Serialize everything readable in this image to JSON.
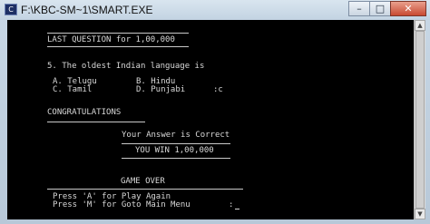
{
  "window": {
    "title": "F:\\KBC-SM~1\\SMART.EXE",
    "icon": "app-icon",
    "controls": {
      "minimize": "–",
      "maximize": "□",
      "close": "✕"
    }
  },
  "console": {
    "header": "LAST QUESTION for 1,00,000",
    "question": "5. The oldest Indian language is",
    "options": {
      "a": "A. Telugu",
      "b": "B. Hindu",
      "c": "C. Tamil",
      "d": "D. Punjabi"
    },
    "answer_prompt": ":c",
    "congrats": "CONGRATULATIONS",
    "result": "Your Answer is Correct",
    "win": "YOU WIN 1,00,000",
    "game_over": "GAME OVER",
    "play_again": "Press 'A' for Play Again",
    "main_menu": "Press 'M' for Goto Main Menu",
    "input_prompt": ":"
  }
}
